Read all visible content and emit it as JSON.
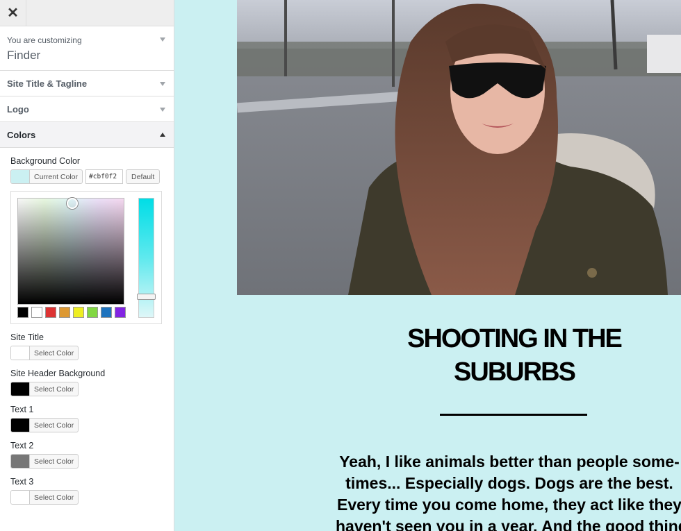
{
  "sidebar": {
    "header": {
      "customizing_label": "You are customizing",
      "theme_name": "Finder"
    },
    "sections": [
      {
        "label": "Site Title & Tagline"
      },
      {
        "label": "Logo"
      },
      {
        "label": "Colors"
      }
    ],
    "colors": {
      "background": {
        "label": "Background Color",
        "current_label": "Current Color",
        "hex_value": "#cbf0f2",
        "default_label": "Default",
        "swatch": "#cbf0f2",
        "palette": [
          "#000000",
          "#ffffff",
          "#dd3333",
          "#dd9933",
          "#eeee22",
          "#81d742",
          "#1e73be",
          "#8224e3"
        ]
      },
      "controls": [
        {
          "label": "Site Title",
          "button": "Select Color",
          "swatch": "#ffffff"
        },
        {
          "label": "Site Header Background",
          "button": "Select Color",
          "swatch": "#000000"
        },
        {
          "label": "Text 1",
          "button": "Select Color",
          "swatch": "#000000"
        },
        {
          "label": "Text 2",
          "button": "Select Color",
          "swatch": "#777777"
        },
        {
          "label": "Text 3",
          "button": "Select Color",
          "swatch": "#ffffff"
        }
      ]
    }
  },
  "preview": {
    "post_title_line1": "SHOOTING IN THE",
    "post_title_line2": "SUBURBS",
    "body_lines": [
      "Yeah, I like animals better than people some-",
      "times... Especially dogs. Dogs are the best.",
      "Every time you come home, they act like they",
      "haven't seen you in a year. And the good thing"
    ]
  },
  "icons": {
    "close": "close-icon",
    "expand": "chevron-down-icon",
    "collapse": "chevron-up-icon"
  }
}
